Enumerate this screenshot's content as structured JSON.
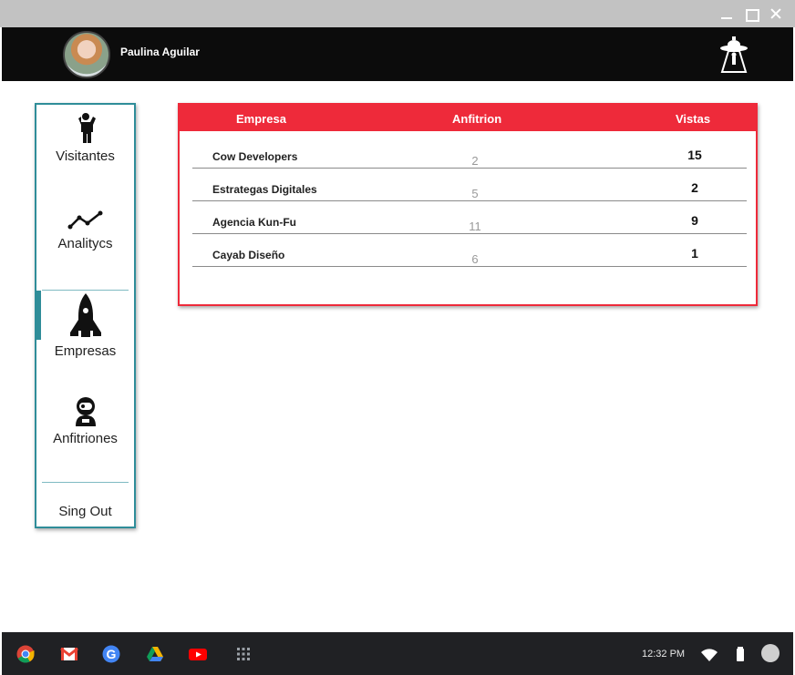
{
  "user": {
    "name": "Paulina Aguilar"
  },
  "sidebar": {
    "items": [
      {
        "label": "Visitantes",
        "icon": "person-icon"
      },
      {
        "label": "Analitycs",
        "icon": "trend-line-icon"
      },
      {
        "label": "Empresas",
        "icon": "rocket-icon",
        "active": true
      },
      {
        "label": "Anfitriones",
        "icon": "astronaut-icon"
      }
    ],
    "signout_label": "Sing Out"
  },
  "table": {
    "headers": {
      "empresa": "Empresa",
      "anfitrion": "Anfitrion",
      "vistas": "Vistas"
    },
    "rows": [
      {
        "empresa": "Cow Developers",
        "anfitrion": "2",
        "vistas": "15"
      },
      {
        "empresa": "Estrategas Digitales",
        "anfitrion": "5",
        "vistas": "2"
      },
      {
        "empresa": "Agencia Kun-Fu",
        "anfitrion": "11",
        "vistas": "9"
      },
      {
        "empresa": "Cayab Diseño",
        "anfitrion": "6",
        "vistas": "1"
      }
    ]
  },
  "taskbar": {
    "apps": [
      "chrome-icon",
      "gmail-icon",
      "google-icon",
      "drive-icon",
      "youtube-icon",
      "launcher-icon"
    ],
    "time": "12:32 PM"
  },
  "colors": {
    "accent_teal": "#2f8d99",
    "accent_red": "#ee2a3a",
    "header_bg": "#0c0c0c"
  }
}
